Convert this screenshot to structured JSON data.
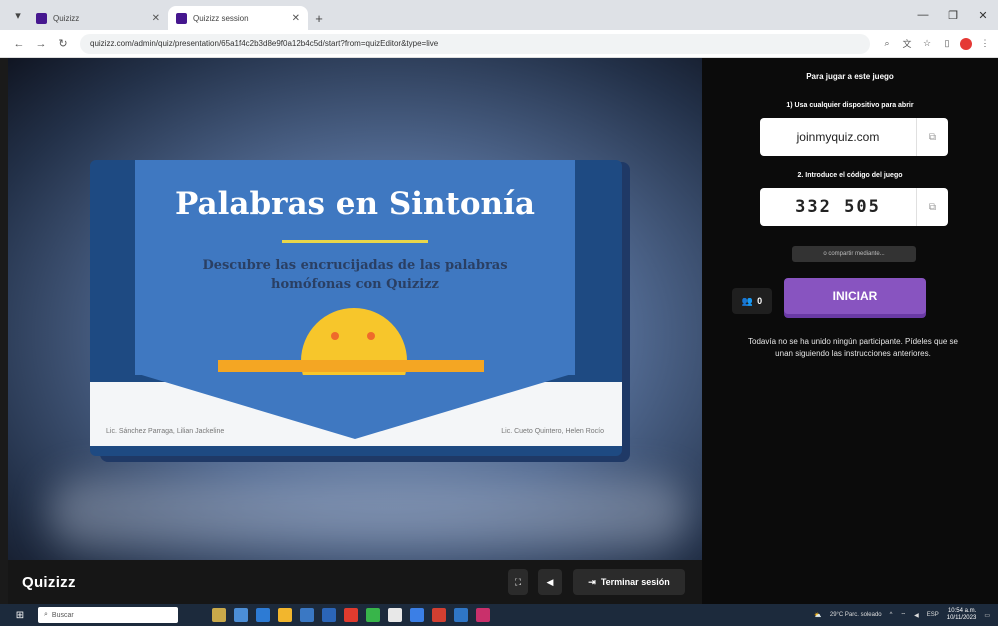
{
  "browser": {
    "tabs": [
      {
        "title": "Quizizz",
        "active": false
      },
      {
        "title": "Quizizz session",
        "active": true
      }
    ],
    "url": "quizizz.com/admin/quiz/presentation/65a1f4c2b3d8e9f0a12b4c5d/start?from=quizEditor&type=live"
  },
  "slide": {
    "title": "Palabras en Sintonía",
    "subtitle": "Descubre las encrucijadas de las palabras homófonas con Quizizz",
    "author_left": "Lic. Sánchez Parraga, Lilian Jackeline",
    "author_right": "Lic. Cueto Quintero, Helen Rocío"
  },
  "bottom_bar": {
    "logo": "Quizizz",
    "end_session_label": "Terminar sesión"
  },
  "side_panel": {
    "title": "Para jugar a este juego",
    "step1": "1) Usa cualquier dispositivo para abrir",
    "join_url": "joinmyquiz.com",
    "step2": "2. Introduce el código del juego",
    "game_code": "332 505",
    "share_label": "o compartir mediante...",
    "participant_count": "0",
    "start_label": "INICIAR",
    "waiting_message": "Todavía no se ha unido ningún participante. Pídeles que se unan siguiendo las instrucciones anteriores."
  },
  "taskbar": {
    "search_placeholder": "Buscar",
    "weather": "29°C Parc. soleado",
    "lang": "ESP",
    "time": "10:54 a.m.",
    "date": "10/11/2023"
  },
  "colors": {
    "accent_purple": "#8854c0",
    "slide_blue": "#3f78c1",
    "panel_bg": "#0b0b0b"
  }
}
